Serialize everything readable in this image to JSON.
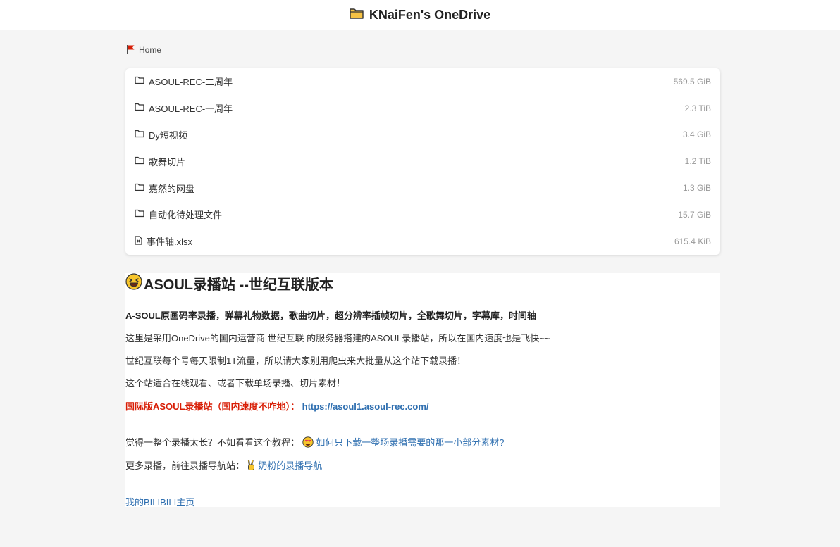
{
  "header": {
    "title": "KNaiFen's OneDrive",
    "icon": "folder-icon"
  },
  "breadcrumb": {
    "label": "Home",
    "icon": "flag-icon"
  },
  "files": [
    {
      "name": "ASOUL-REC-二周年",
      "size": "569.5 GiB",
      "type": "folder"
    },
    {
      "name": "ASOUL-REC-一周年",
      "size": "2.3 TiB",
      "type": "folder"
    },
    {
      "name": "Dy短视频",
      "size": "3.4 GiB",
      "type": "folder"
    },
    {
      "name": "歌舞切片",
      "size": "1.2 TiB",
      "type": "folder"
    },
    {
      "name": "嘉然的网盘",
      "size": "1.3 GiB",
      "type": "folder"
    },
    {
      "name": "自动化待处理文件",
      "size": "15.7 GiB",
      "type": "folder"
    },
    {
      "name": "事件轴.xlsx",
      "size": "615.4 KiB",
      "type": "file"
    }
  ],
  "readme": {
    "title": "ASOUL录播站 --世纪互联版本",
    "subtitle": "A-SOUL原画码率录播，弹幕礼物数据，歌曲切片，超分辨率插帧切片，全歌舞切片，字幕库，时间轴",
    "line1": "这里是采用OneDrive的国内运营商 世纪互联 的服务器搭建的ASOUL录播站，所以在国内速度也是飞快~~",
    "line2": "世纪互联每个号每天限制1T流量，所以请大家别用爬虫来大批量从这个站下载录播！",
    "line3": "这个站适合在线观看、或者下载单场录播、切片素材！",
    "intl_label": "国际版ASOUL录播站（国内速度不咋地）：",
    "intl_link": "https://asoul1.asoul-rec.com/",
    "tutorial_prefix": "觉得一整个录播太长？不如看看这个教程：",
    "tutorial_link": "如何只下载一整场录播需要的那一小部分素材?",
    "nav_prefix": "更多录播，前往录播导航站：",
    "nav_link": "奶粉的录播导航",
    "bilibili_link": "我的BILIBILI主页"
  },
  "colors": {
    "accent_link": "#2f6fb0",
    "warning_red": "#d81e06"
  }
}
